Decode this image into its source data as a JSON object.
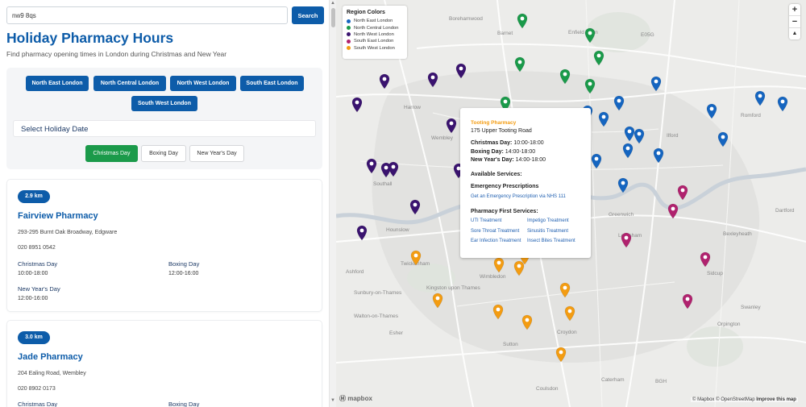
{
  "search": {
    "value": "nw9 8qs",
    "button_label": "Search"
  },
  "header": {
    "title": "Holiday Pharmacy Hours",
    "subtitle": "Find pharmacy opening times in London during Christmas and New Year"
  },
  "regions": [
    "North East London",
    "North Central London",
    "North West London",
    "South East London",
    "South West London"
  ],
  "date_select": {
    "label": "Select Holiday Date",
    "options": [
      "Christmas Day",
      "Boxing Day",
      "New Year's Day"
    ],
    "active": "Christmas Day"
  },
  "results": [
    {
      "distance": "2.9 km",
      "name": "Fairview Pharmacy",
      "address": "293-295 Burnt Oak Broadway, Edgware",
      "phone": "020 8951 0542",
      "hours": [
        {
          "label": "Christmas Day",
          "value": "10:00-18:00"
        },
        {
          "label": "Boxing Day",
          "value": "12:00-16:00"
        },
        {
          "label": "New Year's Day",
          "value": "12:00-16:00"
        }
      ]
    },
    {
      "distance": "3.0 km",
      "name": "Jade Pharmacy",
      "address": "204 Ealing Road, Wembley",
      "phone": "020 8902 0173",
      "hours": [
        {
          "label": "Christmas Day",
          "value": ""
        },
        {
          "label": "Boxing Day",
          "value": ""
        }
      ]
    }
  ],
  "legend": {
    "title": "Region Colors",
    "items": [
      {
        "label": "North East London",
        "color": "#1565c0"
      },
      {
        "label": "North Central London",
        "color": "#1a9a4a"
      },
      {
        "label": "North West London",
        "color": "#3a136f"
      },
      {
        "label": "South East London",
        "color": "#b0226e"
      },
      {
        "label": "South West London",
        "color": "#f39c12"
      }
    ]
  },
  "popup": {
    "name": "Tooting Pharmacy",
    "address": "175 Upper Tooting Road",
    "hours": [
      {
        "label": "Christmas Day:",
        "value": "10:00-18:00"
      },
      {
        "label": "Boxing Day:",
        "value": "14:00-18:00"
      },
      {
        "label": "New Year's Day:",
        "value": "14:00-18:00"
      }
    ],
    "services_heading": "Available Services:",
    "emergency_heading": "Emergency Prescriptions",
    "emergency_link": "Get an Emergency Prescription via NHS 111",
    "pharmacy_first_heading": "Pharmacy First Services:",
    "services": [
      "UTI Treatment",
      "Impetigo Treatment",
      "Sore Throat Treatment",
      "Sinusitis Treatment",
      "Ear Infection Treatment",
      "Insect Bites Treatment"
    ]
  },
  "map_labels": [
    "Borehamwood",
    "Barnet",
    "Enfield Town",
    "E05G",
    "Harrow",
    "Wembley",
    "Southall",
    "Hounslow",
    "Romford",
    "Ilford",
    "Greenwich",
    "Lewisham",
    "Bexleyheath",
    "Sidcup",
    "Swanley",
    "Orpington",
    "Croydon",
    "Sutton",
    "Kingston upon Thames",
    "Sunbury-on-Thames",
    "Walton-on-Thames",
    "Esher",
    "Caterham",
    "Coulsdon",
    "Ashford",
    "Twickenham",
    "Wimbledon",
    "BGH",
    "Dartford"
  ],
  "zoom": {
    "in": "+",
    "out": "−",
    "compass": "▲"
  },
  "attribution": {
    "logo": "mapbox",
    "mapbox": "© Mapbox",
    "osm": "© OpenStreetMap",
    "improve": "Improve this map"
  }
}
